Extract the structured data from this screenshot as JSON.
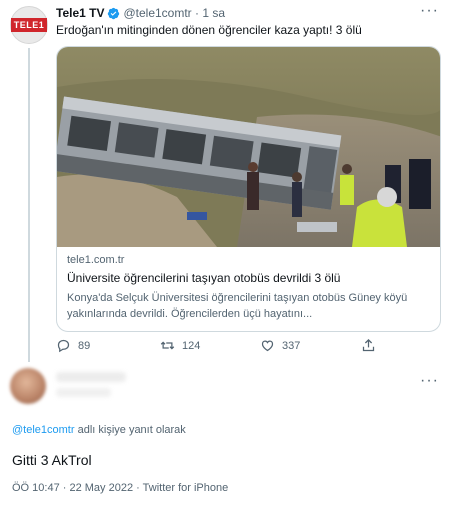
{
  "original_tweet": {
    "avatar_logo": "TELE1",
    "author_name": "Tele1 TV",
    "handle": "@tele1comtr",
    "separator": "·",
    "time": "1 sa",
    "text": "Erdoğan'ın mitinginden dönen öğrenciler kaza yaptı! 3 ölü",
    "card": {
      "domain": "tele1.com.tr",
      "title": "Üniversite öğrencilerini taşıyan otobüs devrildi 3 ölü",
      "description": "Konya'da Selçuk Üniversitesi öğrencilerini taşıyan otobüs Güney köyü yakınlarında devrildi. Öğrencilerden üçü hayatını..."
    },
    "actions": {
      "replies": "89",
      "retweets": "124",
      "likes": "337"
    }
  },
  "reply_tweet": {
    "reply_to_mention": "@tele1comtr",
    "reply_to_suffix": " adlı kişiye yanıt olarak",
    "text": "Gitti 3 AkTrol",
    "timestamp": "ÖÖ 10:47 · 22 May 2022 · Twitter for iPhone"
  },
  "colors": {
    "accent_blue": "#1d9bf0",
    "secondary_text": "#536471",
    "brand_red": "#d0262c"
  },
  "icons": {
    "verified": "verified-badge-icon",
    "more": "more-horizontal-icon",
    "reply": "reply-icon",
    "retweet": "retweet-icon",
    "like": "heart-icon",
    "share": "share-icon"
  }
}
